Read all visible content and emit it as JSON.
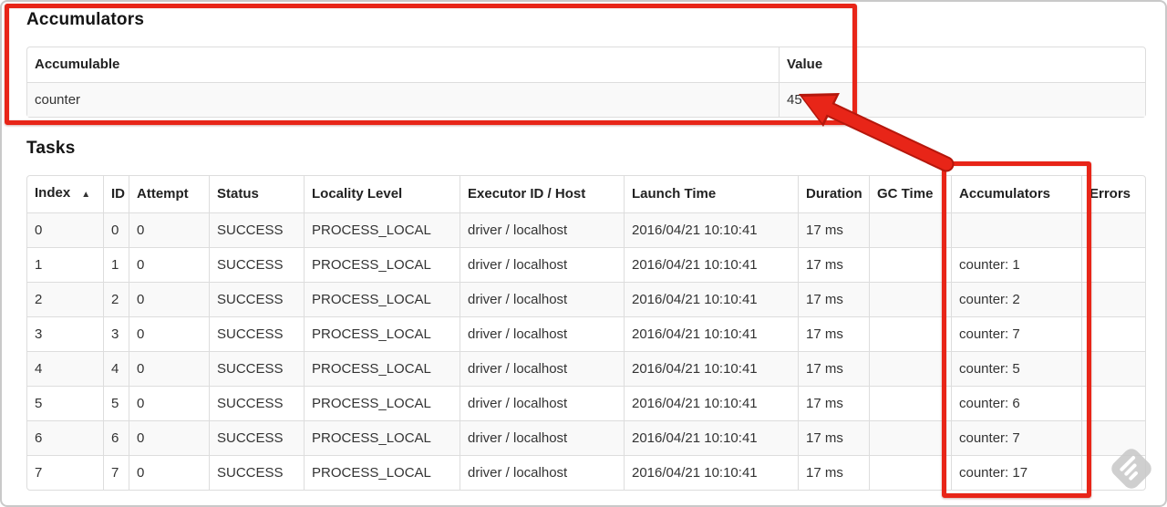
{
  "accumulators_section": {
    "heading": "Accumulators",
    "table": {
      "headers": [
        "Accumulable",
        "Value"
      ],
      "rows": [
        [
          "counter",
          "45"
        ]
      ]
    }
  },
  "tasks_section": {
    "heading": "Tasks",
    "table": {
      "headers": [
        "Index",
        "ID",
        "Attempt",
        "Status",
        "Locality Level",
        "Executor ID / Host",
        "Launch Time",
        "Duration",
        "GC Time",
        "Accumulators",
        "Errors"
      ],
      "sorted_column": "Index",
      "sort_icon": "▲",
      "rows": [
        [
          "0",
          "0",
          "0",
          "SUCCESS",
          "PROCESS_LOCAL",
          "driver / localhost",
          "2016/04/21 10:10:41",
          "17 ms",
          "",
          "",
          ""
        ],
        [
          "1",
          "1",
          "0",
          "SUCCESS",
          "PROCESS_LOCAL",
          "driver / localhost",
          "2016/04/21 10:10:41",
          "17 ms",
          "",
          "counter: 1",
          ""
        ],
        [
          "2",
          "2",
          "0",
          "SUCCESS",
          "PROCESS_LOCAL",
          "driver / localhost",
          "2016/04/21 10:10:41",
          "17 ms",
          "",
          "counter: 2",
          ""
        ],
        [
          "3",
          "3",
          "0",
          "SUCCESS",
          "PROCESS_LOCAL",
          "driver / localhost",
          "2016/04/21 10:10:41",
          "17 ms",
          "",
          "counter: 7",
          ""
        ],
        [
          "4",
          "4",
          "0",
          "SUCCESS",
          "PROCESS_LOCAL",
          "driver / localhost",
          "2016/04/21 10:10:41",
          "17 ms",
          "",
          "counter: 5",
          ""
        ],
        [
          "5",
          "5",
          "0",
          "SUCCESS",
          "PROCESS_LOCAL",
          "driver / localhost",
          "2016/04/21 10:10:41",
          "17 ms",
          "",
          "counter: 6",
          ""
        ],
        [
          "6",
          "6",
          "0",
          "SUCCESS",
          "PROCESS_LOCAL",
          "driver / localhost",
          "2016/04/21 10:10:41",
          "17 ms",
          "",
          "counter: 7",
          ""
        ],
        [
          "7",
          "7",
          "0",
          "SUCCESS",
          "PROCESS_LOCAL",
          "driver / localhost",
          "2016/04/21 10:10:41",
          "17 ms",
          "",
          "counter: 17",
          ""
        ]
      ]
    }
  },
  "annotations": {
    "color": "#e82518",
    "outline_color": "#b5170c",
    "box_targets": [
      "accumulators-section",
      "accumulators-column"
    ],
    "arrow_target": "accumulator-value-45"
  },
  "watermark_icon": "feedly-logo-icon"
}
